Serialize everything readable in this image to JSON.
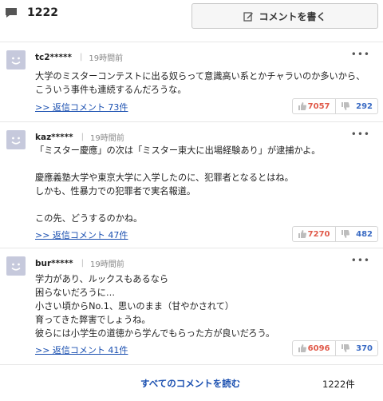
{
  "header": {
    "comment_count": "1222",
    "write_button_label": "コメントを書く"
  },
  "comments": [
    {
      "user": "tc2*****",
      "time": "19時間前",
      "body": "大学のミスターコンテストに出る奴らって意識高い系とかチャラいのか多いから、こういう事件も連続するんだろうな。",
      "reply_link": ">> 返信コメント 73件",
      "good": "7057",
      "bad": "292"
    },
    {
      "user": "kaz*****",
      "time": "19時間前",
      "body": "「ミスター慶應」の次は「ミスター東大に出場経験あり」が逮捕かよ。\n\n慶應義塾大学や東京大学に入学したのに、犯罪者となるとはね。\nしかも、性暴力での犯罪者で実名報道。\n\nこの先、どうするのかね。",
      "reply_link": ">> 返信コメント 47件",
      "good": "7270",
      "bad": "482"
    },
    {
      "user": "bur*****",
      "time": "19時間前",
      "body": "学力があり、ルックスもあるなら\n困らないだろうに…\n小さい頃からNo.1、思いのまま（甘やかされて）\n育ってきた弊害でしょうね。\n彼らには小学生の道徳から学んでもらった方が良いだろう。",
      "reply_link": ">> 返信コメント 41件",
      "good": "6096",
      "bad": "370"
    }
  ],
  "footer": {
    "all_comments_link": "すべてのコメントを読む",
    "total": "1222件"
  },
  "colors": {
    "link": "#1a4fb0",
    "good": "#e05a4a",
    "bad": "#3a6bc4",
    "avatar": "#c6c9dc"
  }
}
